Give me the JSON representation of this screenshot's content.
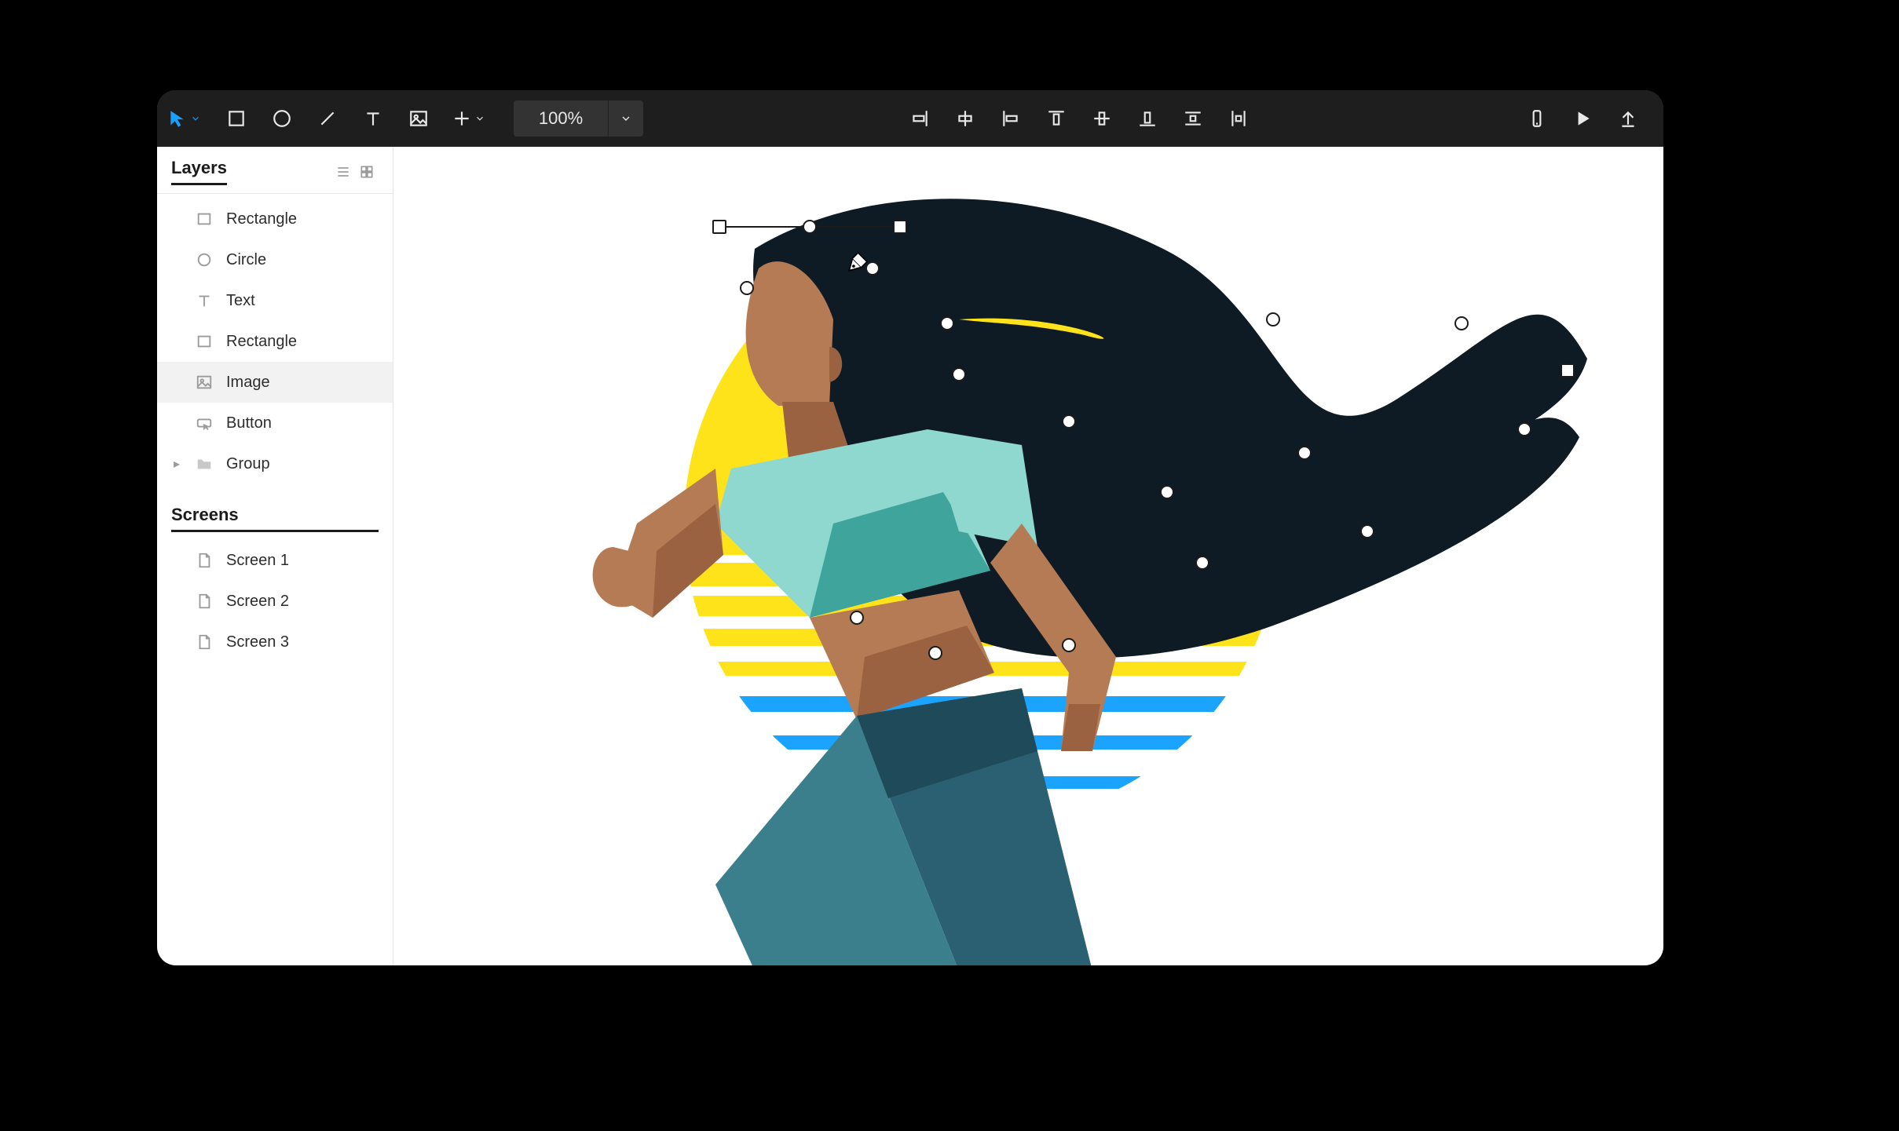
{
  "toolbar": {
    "zoom": "100%"
  },
  "sidebar": {
    "layers_title": "Layers",
    "screens_title": "Screens",
    "layers": [
      {
        "label": "Rectangle",
        "icon": "rect"
      },
      {
        "label": "Circle",
        "icon": "circle"
      },
      {
        "label": "Text",
        "icon": "text"
      },
      {
        "label": "Rectangle",
        "icon": "rect"
      },
      {
        "label": "Image",
        "icon": "image",
        "selected": true
      },
      {
        "label": "Button",
        "icon": "button"
      },
      {
        "label": "Group",
        "icon": "folder",
        "expandable": true
      }
    ],
    "screens": [
      {
        "label": "Screen 1"
      },
      {
        "label": "Screen 2"
      },
      {
        "label": "Screen 3"
      }
    ]
  },
  "colors": {
    "accent": "#19a0ff",
    "sun": "#ffe31a",
    "ocean": "#1ba4ff",
    "hair": "#0e1a24",
    "skin1": "#b57b54",
    "skin2": "#9a6240",
    "top1": "#8fd8cf",
    "top2": "#3fa59c",
    "pant1": "#3b7f8c",
    "pant2": "#2a6071",
    "pant3": "#1f4a59"
  }
}
